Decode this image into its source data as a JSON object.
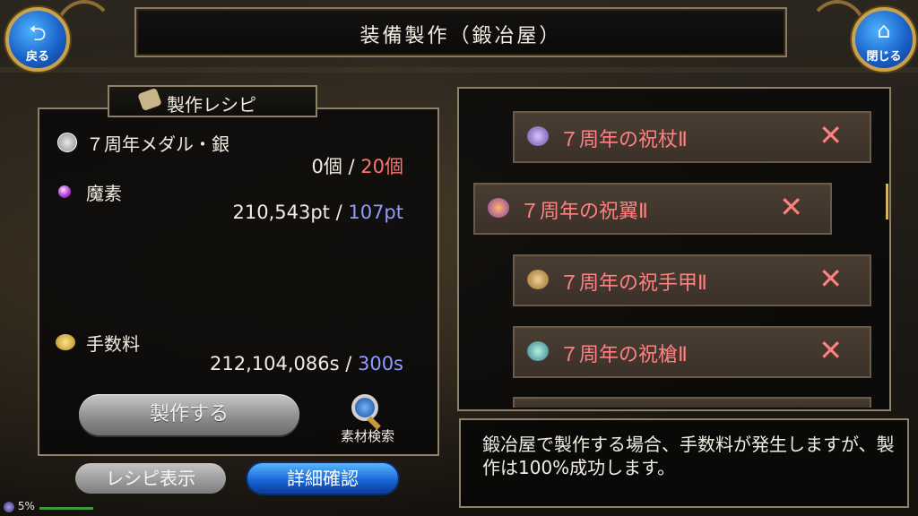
{
  "header": {
    "title": "装備製作（鍛冶屋）",
    "back_label": "戻る",
    "close_label": "閉じる"
  },
  "recipe": {
    "heading": "製作レシピ",
    "materials": [
      {
        "name": "７周年メダル・銀",
        "have": "0個",
        "sep": " / ",
        "need": "20個",
        "icon": "silver-medal-icon"
      },
      {
        "name": "魔素",
        "have": "210,543pt",
        "sep": " / ",
        "need": "107pt",
        "icon": "mana-orb-icon"
      }
    ],
    "fee": {
      "name": "手数料",
      "have": "212,104,086s",
      "sep": " / ",
      "need": "300s",
      "icon": "coins-icon"
    },
    "make_button": "製作する",
    "search_label": "素材検索",
    "show_recipe_button": "レシピ表示",
    "detail_button": "詳細確認"
  },
  "list": {
    "items": [
      {
        "name": "７周年の祝杖Ⅱ",
        "mark": "✕",
        "icon": "staff-icon"
      },
      {
        "name": "７周年の祝翼Ⅱ",
        "mark": "✕",
        "icon": "wing-icon"
      },
      {
        "name": "７周年の祝手甲Ⅱ",
        "mark": "✕",
        "icon": "gauntlet-icon"
      },
      {
        "name": "７周年の祝槍Ⅱ",
        "mark": "✕",
        "icon": "spear-icon"
      }
    ]
  },
  "message": "鍛冶屋で製作する場合、手数料が発生しますが、製作は100%成功します。",
  "status": {
    "battery": "5%"
  },
  "colors": {
    "need_red": "#ff7272",
    "need_blue": "#8f9bff",
    "item_red": "#ff8080",
    "accent_blue": "#1561d3"
  }
}
